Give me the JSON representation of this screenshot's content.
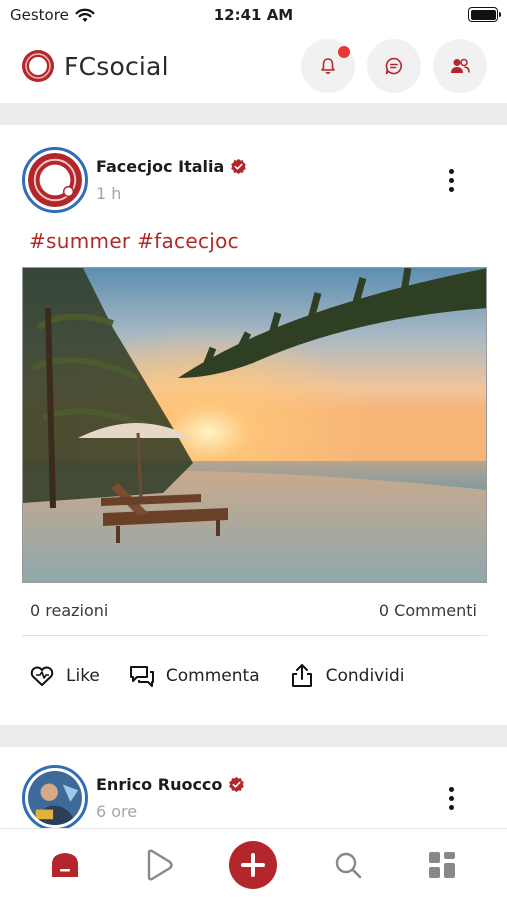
{
  "status_bar": {
    "carrier": "Gestore",
    "time": "12:41 AM",
    "battery_level": 1.0
  },
  "header": {
    "brand": "FCsocial",
    "notification_dot": true
  },
  "posts": [
    {
      "author": "Facecjoc Italia",
      "time_ago": "1 h",
      "text": "#summer #facecjoc",
      "reactions": "0 reazioni",
      "comments": "0 Commenti",
      "actions": {
        "like": "Like",
        "comment": "Commenta",
        "share": "Condividi"
      }
    },
    {
      "author": "Enrico Ruocco",
      "time_ago": "6 ore"
    }
  ],
  "colors": {
    "brand": "#b3262b",
    "hashtag": "#b02a2a",
    "avatar_ring": "#2f6fb7"
  }
}
